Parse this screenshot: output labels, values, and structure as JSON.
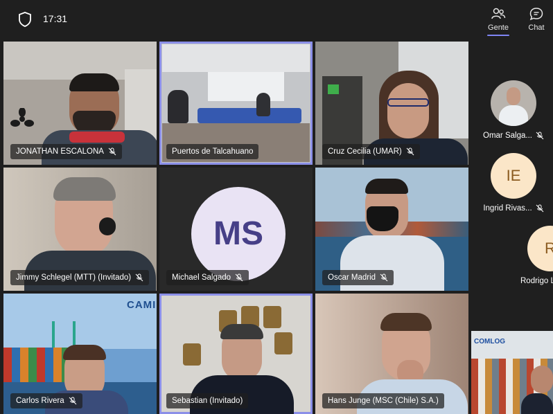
{
  "topbar": {
    "time": "17:31",
    "people_label": "Gente",
    "chat_label": "Chat"
  },
  "tiles": [
    {
      "name": "JONATHAN ESCALONA"
    },
    {
      "name": "Puertos de Talcahuano"
    },
    {
      "name": "Cruz Cecilia (UMAR)"
    },
    {
      "name": "Jimmy Schlegel (MTT) (Invitado)"
    },
    {
      "name": "Michael Salgado",
      "initials": "MS"
    },
    {
      "name": "Oscar Madrid"
    },
    {
      "name": "Carlos Rivera",
      "logo_text": "CAMI"
    },
    {
      "name": "Sebastian (Invitado)"
    },
    {
      "name": "Hans Junge (MSC (Chile) S.A.)"
    }
  ],
  "side_participants": [
    {
      "name": "Omar Salga...",
      "initials": ""
    },
    {
      "name": "Ingrid Rivas...",
      "initials": "IE"
    },
    {
      "name": "Rodrigo L",
      "initials": "R"
    }
  ],
  "side_video": {
    "logo_text": "COMLOG"
  },
  "colors": {
    "active_outline": "#8b8fe8",
    "avatar_bg": "#e9e3f4",
    "avatar_text": "#463f87",
    "side_avatar_bg": "#fbe6c8",
    "side_avatar_text": "#8a5a1f"
  }
}
